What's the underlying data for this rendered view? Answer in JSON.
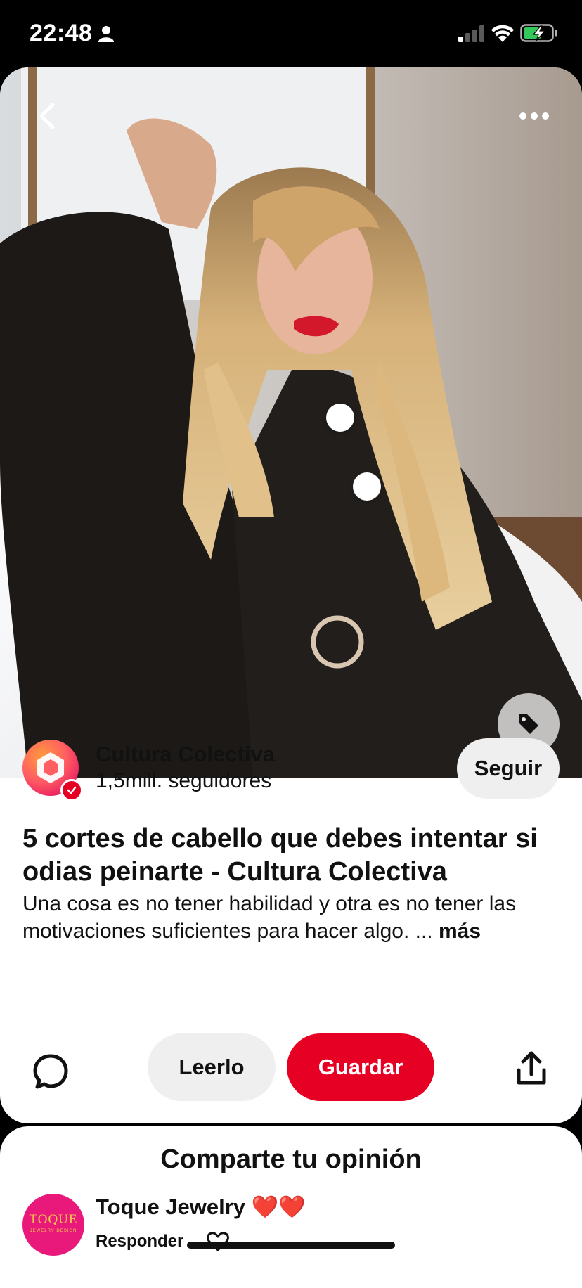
{
  "status_bar": {
    "time": "22:48",
    "icons": [
      "person-icon",
      "cellular-signal-icon",
      "wifi-icon",
      "battery-charging-icon"
    ],
    "battery_color": "#34c759"
  },
  "pin": {
    "image_description_icons": [
      "back-icon",
      "more-options-icon",
      "shopping-tag-icon"
    ],
    "hotspots": 2
  },
  "creator": {
    "name": "Cultura Colectiva",
    "followers": "1,5mill. seguidores",
    "follow_label": "Seguir",
    "verified": true
  },
  "pin_text": {
    "title": "5 cortes de cabello que debes intentar si odias peinarte - Cultura Colectiva",
    "description": "Una cosa es no tener habilidad y otra es no tener las motivaciones suficientes para hacer algo. ...",
    "more_label": "más"
  },
  "actions": {
    "read_label": "Leerlo",
    "save_label": "Guardar",
    "save_color": "#e60023"
  },
  "opinion": {
    "title": "Comparte tu opinión",
    "comment_author": "Toque Jewelry ❤️❤️",
    "reply_label": "Responder",
    "avatar_brand": "TOQUE",
    "avatar_brand_sub": "JEWELRY DESIGN"
  }
}
